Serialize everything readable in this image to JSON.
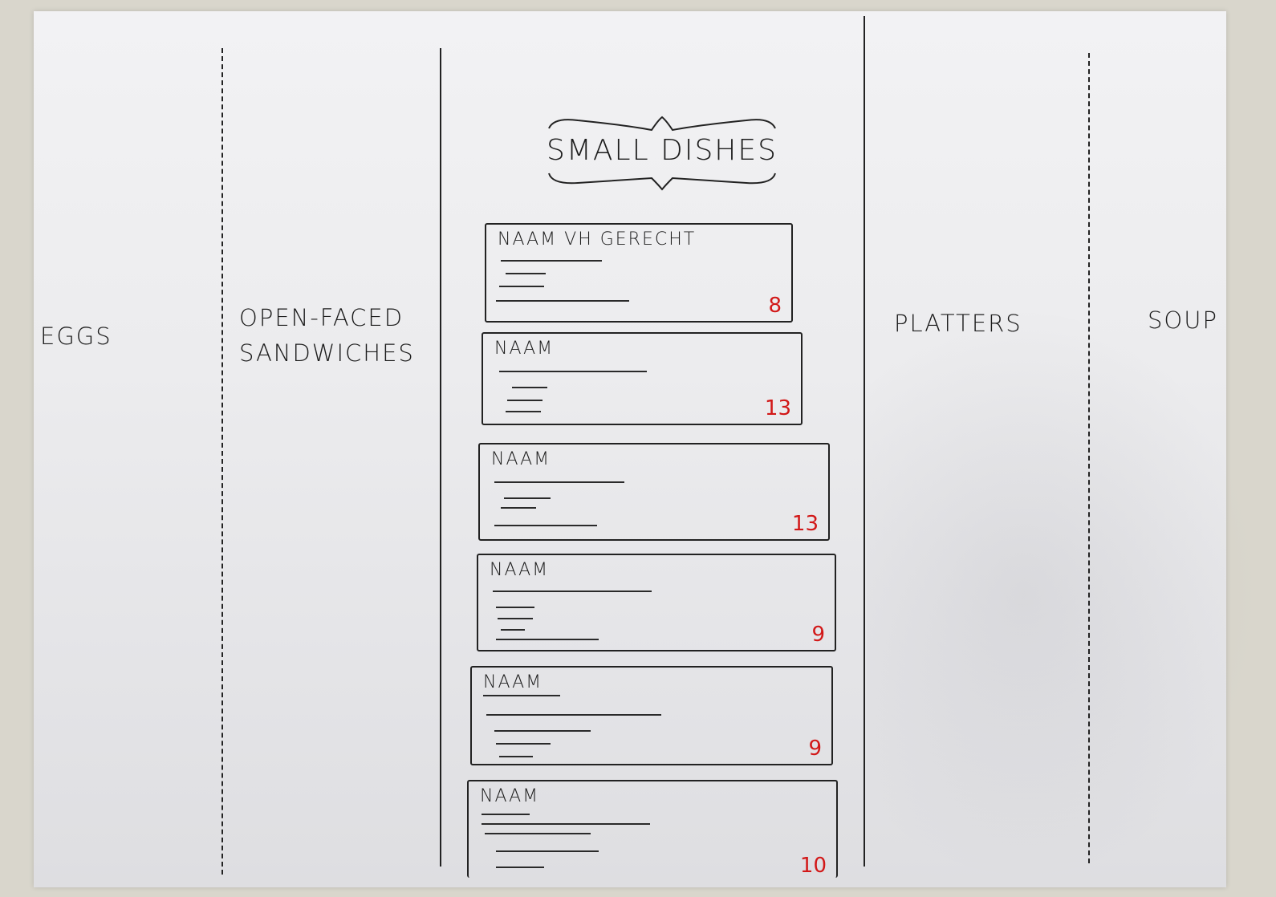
{
  "categories": {
    "eggs": "EGGS",
    "open_faced_line1": "OPEN-FACED",
    "open_faced_line2": "SANDWICHES",
    "platters": "PLATTERS",
    "soup": "SOUP"
  },
  "title": "SMALL DISHES",
  "dishes": [
    {
      "name": "NAAM VH GERECHT",
      "price": "8"
    },
    {
      "name": "NAAM",
      "price": "13"
    },
    {
      "name": "NAAM",
      "price": "13"
    },
    {
      "name": "NAAM",
      "price": "9"
    },
    {
      "name": "NAAM",
      "price": "9"
    },
    {
      "name": "NAAM",
      "price": "10"
    }
  ],
  "colors": {
    "ink": "#1c1c1c",
    "price": "#d21818",
    "paper": "#eeeef0"
  }
}
